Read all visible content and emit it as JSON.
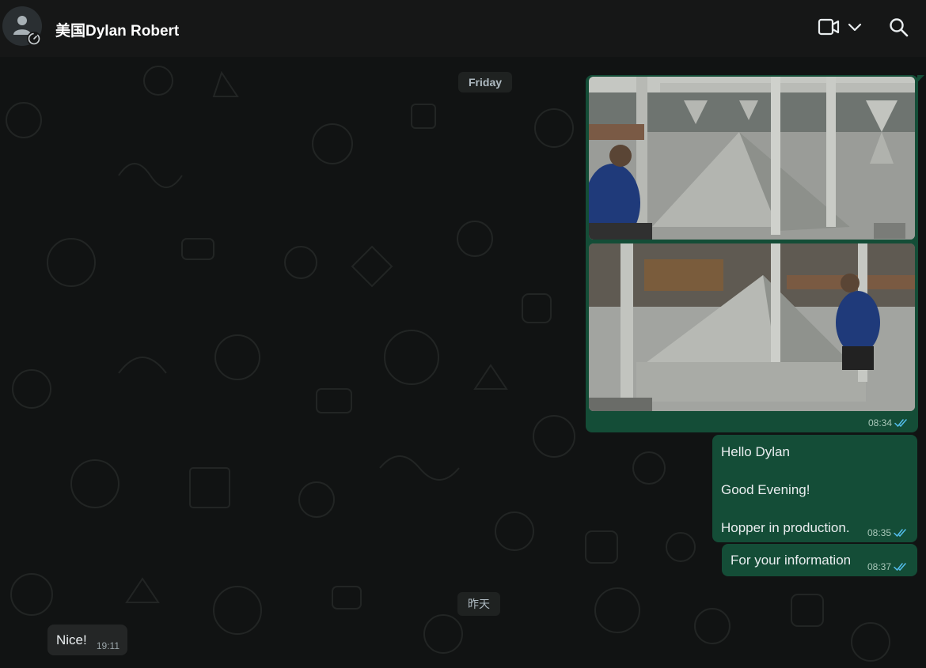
{
  "header": {
    "contact_name": "美国Dylan Robert",
    "icons": [
      "default-avatar-icon",
      "status-icon",
      "video-call-icon",
      "chevron-down-icon",
      "search-icon"
    ]
  },
  "chat": {
    "dates": {
      "friday": "Friday",
      "yesterday": "昨天"
    },
    "messages": [
      {
        "type": "image",
        "direction": "outgoing",
        "images": 2,
        "time": "08:34",
        "status": "read"
      },
      {
        "type": "text",
        "direction": "outgoing",
        "lines": [
          "Hello Dylan",
          "",
          "Good Evening!",
          "",
          "Hopper in production."
        ],
        "time": "08:35",
        "status": "read"
      },
      {
        "type": "text",
        "direction": "outgoing",
        "text": "For your information",
        "time": "08:37",
        "status": "read"
      },
      {
        "type": "text",
        "direction": "incoming",
        "text": "Nice!",
        "time": "19:11"
      }
    ]
  },
  "colors": {
    "outgoing_bubble": "#144d37",
    "incoming_bubble": "#242626",
    "read_tick": "#53bdeb",
    "background": "#111313"
  }
}
